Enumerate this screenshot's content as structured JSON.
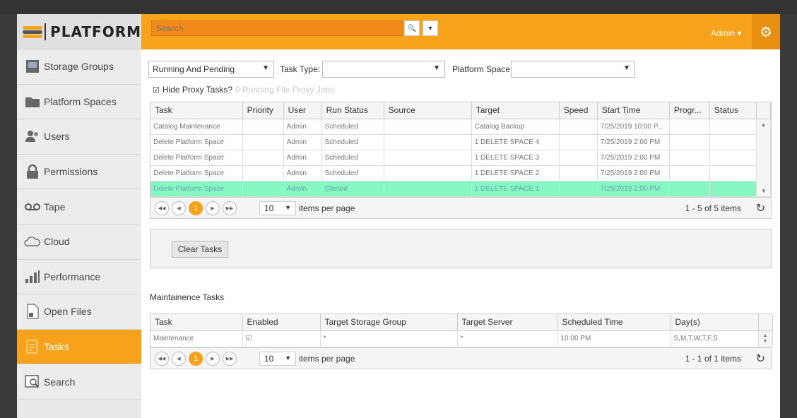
{
  "app": {
    "logo_text": "PLATFORM"
  },
  "sidebar": {
    "items": [
      {
        "label": "Storage Groups",
        "icon": "storage-icon"
      },
      {
        "label": "Platform Spaces",
        "icon": "folder-icon"
      },
      {
        "label": "Users",
        "icon": "users-icon"
      },
      {
        "label": "Permissions",
        "icon": "lock-icon"
      },
      {
        "label": "Tape",
        "icon": "tape-icon"
      },
      {
        "label": "Cloud",
        "icon": "cloud-icon"
      },
      {
        "label": "Performance",
        "icon": "performance-icon"
      },
      {
        "label": "Open Files",
        "icon": "open-files-icon"
      },
      {
        "label": "Tasks",
        "icon": "tasks-icon",
        "active": true
      },
      {
        "label": "Search",
        "icon": "search-doc-icon"
      }
    ]
  },
  "header": {
    "search_placeholder": "Search",
    "user_label": "Admin"
  },
  "filters": {
    "status_select": "Running And Pending",
    "task_type_label": "Task Type:",
    "task_type_value": "",
    "platform_space_label": "Platform Space:",
    "platform_space_value": "",
    "hide_proxy_label": "Hide Proxy Tasks?",
    "proxy_jobs_text": "0 Running File Proxy Jobs"
  },
  "tasks_table": {
    "columns": [
      "Task",
      "Priority",
      "User",
      "Run Status",
      "Source",
      "Target",
      "Speed",
      "Start Time",
      "Progr...",
      "Status"
    ],
    "rows": [
      [
        "Catalog Maintenance",
        "",
        "Admin",
        "Scheduled",
        "",
        "Catalog Backup",
        "",
        "7/25/2019 10:00 P...",
        "",
        ""
      ],
      [
        "Delete Platform Space",
        "",
        "Admin",
        "Scheduled",
        "",
        "1 DELETE SPACE 4",
        "",
        "7/25/2019 2:00 PM",
        "",
        ""
      ],
      [
        "Delete Platform Space",
        "",
        "Admin",
        "Scheduled",
        "",
        "1 DELETE SPACE 3",
        "",
        "7/25/2019 2:00 PM",
        "",
        ""
      ],
      [
        "Delete Platform Space",
        "",
        "Admin",
        "Scheduled",
        "",
        "1 DELETE SPACE 2",
        "",
        "7/25/2019 2:00 PM",
        "",
        ""
      ],
      [
        "Delete Platform Space",
        "",
        "Admin",
        "Started",
        "",
        "1 DELETE SPACE 1",
        "",
        "7/25/2019 2:00 PM",
        "",
        ""
      ]
    ],
    "pager": {
      "current_page": "1",
      "page_size": "10",
      "items_per_page_label": "items per page",
      "info": "1 - 5 of 5 items"
    }
  },
  "clear_button": "Clear Tasks",
  "maintenance": {
    "title": "Maintainence Tasks",
    "columns": [
      "Task",
      "Enabled",
      "Target Storage Group",
      "Target Server",
      "Scheduled Time",
      "Day(s)"
    ],
    "rows": [
      [
        "Maintenance",
        "",
        "*",
        "*",
        "10:00 PM",
        "S,M,T,W,T,F,S"
      ]
    ],
    "pager": {
      "current_page": "1",
      "page_size": "10",
      "items_per_page_label": "items per page",
      "info": "1 - 1 of 1 items"
    }
  },
  "colors": {
    "accent": "#f7a21b",
    "highlight_row": "#86f7c3"
  }
}
